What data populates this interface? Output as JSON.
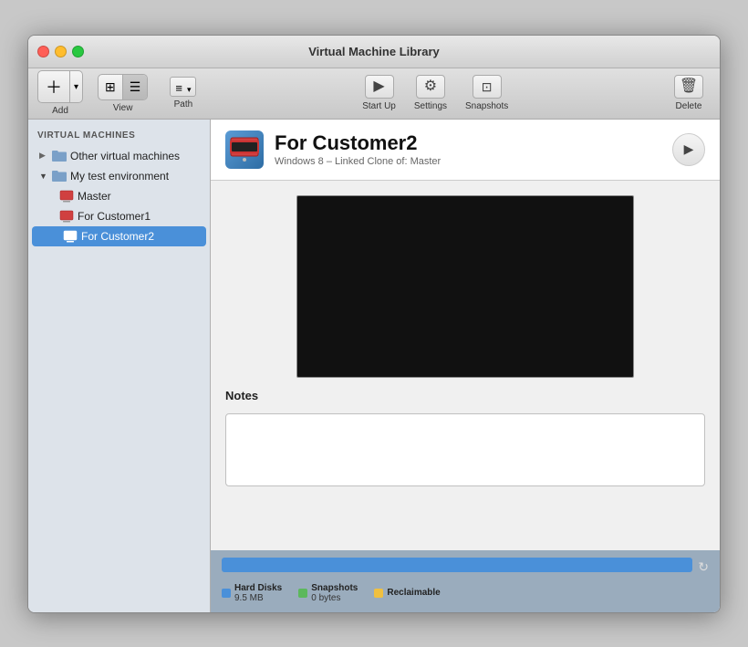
{
  "window": {
    "title": "Virtual Machine Library"
  },
  "toolbar": {
    "add_label": "Add",
    "view_label": "View",
    "path_label": "Path",
    "startup_label": "Start Up",
    "settings_label": "Settings",
    "snapshots_label": "Snapshots",
    "delete_label": "Delete"
  },
  "sidebar": {
    "section_header": "Virtual Machines",
    "items": [
      {
        "id": "other-vms",
        "label": "Other virtual machines",
        "level": 0,
        "disclosure": "▶",
        "icon": "📁"
      },
      {
        "id": "my-test-env",
        "label": "My test environment",
        "level": 0,
        "disclosure": "▼",
        "icon": "📁"
      },
      {
        "id": "master",
        "label": "Master",
        "level": 1,
        "icon": "🖥"
      },
      {
        "id": "customer1",
        "label": "For Customer1",
        "level": 1,
        "icon": "🖥"
      },
      {
        "id": "customer2",
        "label": "For Customer2",
        "level": 1,
        "icon": "🖥",
        "selected": true
      }
    ]
  },
  "detail": {
    "vm_name": "For Customer2",
    "vm_subtitle": "Windows 8 – Linked Clone of: Master",
    "notes_label": "Notes"
  },
  "storage": {
    "legend": [
      {
        "id": "hard-disks",
        "label": "Hard Disks",
        "value": "9.5 MB",
        "color": "#4a90d9"
      },
      {
        "id": "snapshots",
        "label": "Snapshots",
        "value": "0 bytes",
        "color": "#5cb85c"
      },
      {
        "id": "reclaimable",
        "label": "Reclaimable",
        "value": "",
        "color": "#f0c040"
      }
    ]
  }
}
